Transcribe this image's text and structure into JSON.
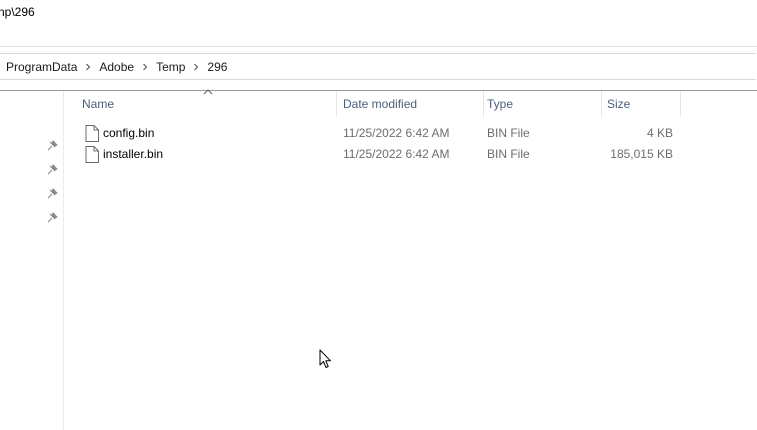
{
  "window": {
    "title": "np\\296"
  },
  "breadcrumb": {
    "items": [
      "ProgramData",
      "Adobe",
      "Temp",
      "296"
    ]
  },
  "nav_pane": {
    "pin_icon": "pin-icon",
    "pins": 4
  },
  "columns": {
    "name": "Name",
    "date_modified": "Date modified",
    "type": "Type",
    "size": "Size"
  },
  "files": [
    {
      "name": "config.bin",
      "date_modified": "11/25/2022 6:42 AM",
      "type": "BIN File",
      "size": "4 KB",
      "icon": "file-icon"
    },
    {
      "name": "installer.bin",
      "date_modified": "11/25/2022 6:42 AM",
      "type": "BIN File",
      "size": "185,015 KB",
      "icon": "file-icon"
    }
  ],
  "colors": {
    "header_text": "#4c607a",
    "secondary_text": "#6d6d6d",
    "divider": "#e5e5e5"
  }
}
